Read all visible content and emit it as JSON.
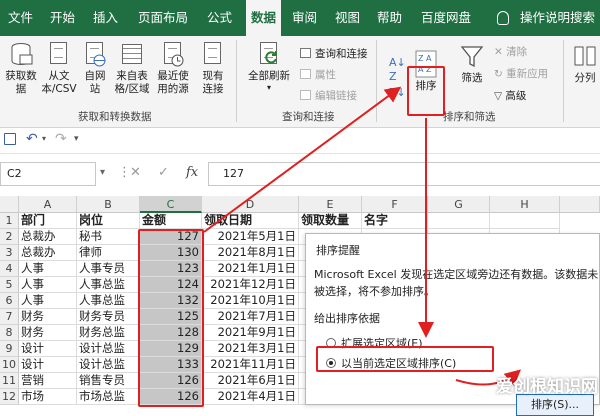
{
  "tabs": [
    "文件",
    "开始",
    "插入",
    "页面布局",
    "公式",
    "数据",
    "审阅",
    "视图",
    "帮助",
    "百度网盘",
    "操作说明搜索"
  ],
  "ribbon": {
    "get_data": "获取数据",
    "from_text": "从文本/CSV",
    "from_web": "自网站",
    "from_table": "来自表格/区域",
    "recent_sources": "最近使用的源",
    "existing_conn": "现有连接",
    "refresh_all": "全部刷新",
    "queries_conn": "查询和连接",
    "properties": "属性",
    "edit_links": "编辑链接",
    "sort": "排序",
    "filter": "筛选",
    "clear": "清除",
    "reapply": "重新应用",
    "advanced": "高级",
    "split": "分列",
    "group_get": "获取和转换数据",
    "group_queries": "查询和连接",
    "group_sort": "排序和筛选"
  },
  "formula": {
    "namebox": "C2",
    "fx": "fx",
    "value": "127"
  },
  "sheet": {
    "columns": [
      "A",
      "B",
      "C",
      "D",
      "E",
      "F",
      "G",
      "H"
    ],
    "rows": [
      {
        "n": "1",
        "a": "部门",
        "b": "岗位",
        "c": "金额",
        "d": "领取日期",
        "e": "领取数量",
        "f": "名字"
      },
      {
        "n": "2",
        "a": "总裁办",
        "b": "秘书",
        "c": "127",
        "d": "2021年5月1日"
      },
      {
        "n": "3",
        "a": "总裁办",
        "b": "律师",
        "c": "130",
        "d": "2021年8月1日"
      },
      {
        "n": "4",
        "a": "人事",
        "b": "人事专员",
        "c": "123",
        "d": "2021年1月1日"
      },
      {
        "n": "5",
        "a": "人事",
        "b": "人事总监",
        "c": "124",
        "d": "2021年12月1日"
      },
      {
        "n": "6",
        "a": "人事",
        "b": "人事总监",
        "c": "132",
        "d": "2021年10月1日"
      },
      {
        "n": "7",
        "a": "财务",
        "b": "财务专员",
        "c": "125",
        "d": "2021年7月1日"
      },
      {
        "n": "8",
        "a": "财务",
        "b": "财务总监",
        "c": "128",
        "d": "2021年9月1日"
      },
      {
        "n": "9",
        "a": "设计",
        "b": "设计总监",
        "c": "129",
        "d": "2021年3月1日"
      },
      {
        "n": "10",
        "a": "设计",
        "b": "设计总监",
        "c": "133",
        "d": "2021年11月1日"
      },
      {
        "n": "11",
        "a": "营销",
        "b": "销售专员",
        "c": "126",
        "d": "2021年6月1日"
      },
      {
        "n": "12",
        "a": "市场",
        "b": "市场总监",
        "c": "126",
        "d": "2021年4月1日"
      }
    ]
  },
  "dialog": {
    "title": "排序提醒",
    "message": "Microsoft Excel 发现在选定区域旁边还有数据。该数据未被选择，将不参加排序。",
    "sub": "给出排序依据",
    "opt_expand": "扩展选定区域(E)",
    "opt_current": "以当前选定区域排序(C)",
    "sort_btn": "排序(S)..."
  },
  "watermark": "爱创根知识网",
  "colors": {
    "ribbon_green": "#1f6f43",
    "highlight_red": "#e02020"
  }
}
